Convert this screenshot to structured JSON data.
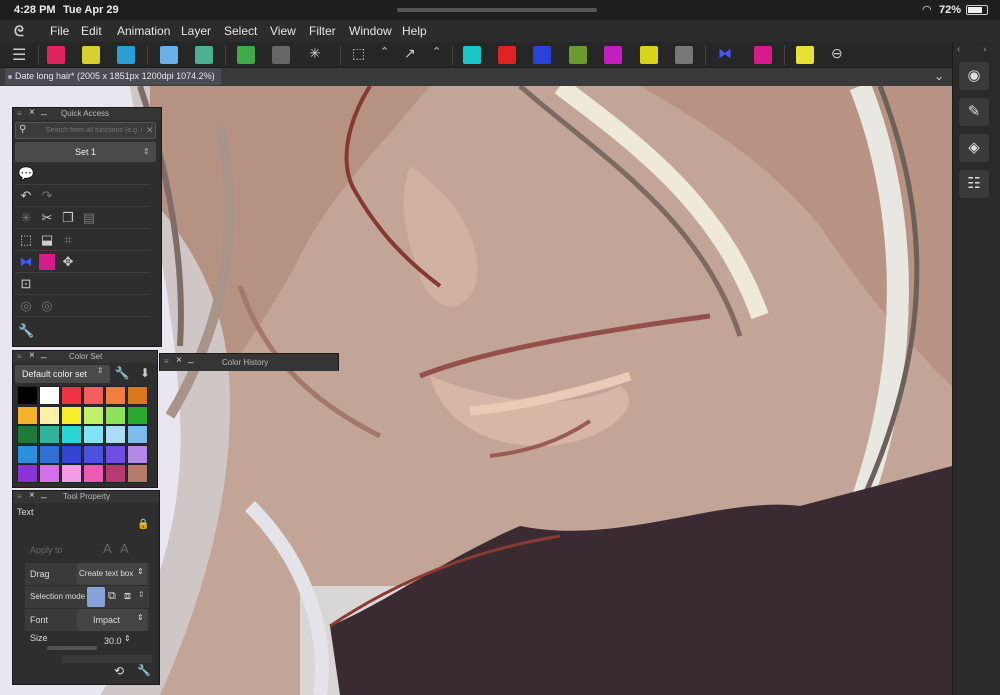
{
  "status_bar": {
    "time": "4:28 PM",
    "date": "Tue Apr 29",
    "battery": "72%"
  },
  "menu": [
    "File",
    "Edit",
    "Animation",
    "Layer",
    "Select",
    "View",
    "Filter",
    "Window",
    "Help"
  ],
  "document_tab": "Date long hair* (2005 x 1851px 1200dpi 1074.2%)",
  "quick_access": {
    "title": "Quick Access",
    "search_placeholder": "Search from all functions (e.g. t",
    "set": "Set 1"
  },
  "color_set": {
    "title": "Color Set",
    "selected": "Default color set",
    "colors": [
      "#000000",
      "#ffffff",
      "#ee3344",
      "#f25d5d",
      "#f07f3c",
      "#d9771c",
      "#f5b22a",
      "#fff0a8",
      "#f7ef2a",
      "#c0f06c",
      "#8fe35a",
      "#2aa830",
      "#1f7a3a",
      "#2fb39b",
      "#29d7d7",
      "#82e4f2",
      "#a9dcf5",
      "#7fbcee",
      "#2b8fe0",
      "#2f6fd8",
      "#3344d1",
      "#4b52e0",
      "#6f4fe3",
      "#b388e8",
      "#8a34d6",
      "#d36fe8",
      "#f39be5",
      "#e95cb4",
      "#b63b70",
      "#b57a6a"
    ]
  },
  "color_history": {
    "title": "Color History"
  },
  "tool_property": {
    "title": "Tool Property",
    "tool": "Text",
    "apply_to": "Apply to",
    "drag_label": "Drag",
    "drag_value": "Create text box",
    "selection_mode": "Selection mode",
    "font_label": "Font",
    "font_value": "Impact",
    "size_label": "Size",
    "size_value": "30.0"
  },
  "colors": {
    "accent_tab": "#4b4b52",
    "panel_bg": "#2e2e2e"
  }
}
